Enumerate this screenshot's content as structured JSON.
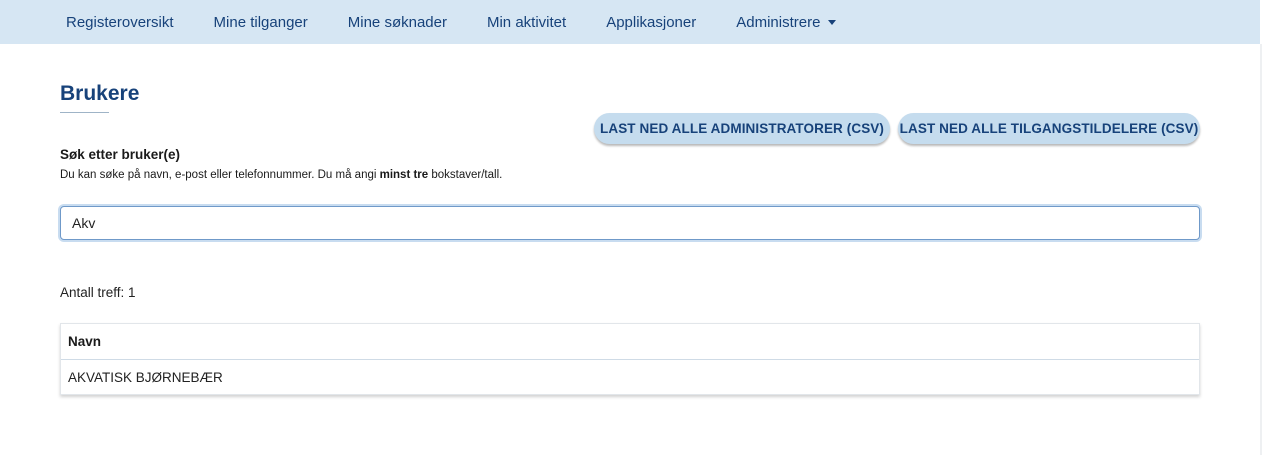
{
  "nav": {
    "items": [
      {
        "label": "Registeroversikt"
      },
      {
        "label": "Mine tilganger"
      },
      {
        "label": "Mine søknader"
      },
      {
        "label": "Min aktivitet"
      },
      {
        "label": "Applikasjoner"
      },
      {
        "label": "Administrere"
      }
    ]
  },
  "page": {
    "title": "Brukere"
  },
  "actions": {
    "download_admins_label": "LAST NED ALLE ADMINISTRATORER (CSV)",
    "download_granters_label": "LAST NED ALLE TILGANGSTILDELERE (CSV)"
  },
  "search": {
    "label": "Søk etter bruker(e)",
    "help_prefix": "Du kan søke på navn, e-post eller telefonnummer. Du må angi ",
    "help_bold": "minst tre",
    "help_suffix": " bokstaver/tall.",
    "value": "Akv"
  },
  "results": {
    "count_text": "Antall treff: 1",
    "columns": [
      "Navn"
    ],
    "rows": [
      {
        "name": "AKVATISK BJØRNEBÆR"
      }
    ]
  },
  "colors": {
    "nav_bg": "#d6e6f3",
    "brand_text": "#17427a",
    "button_bg": "#c5dcee"
  }
}
